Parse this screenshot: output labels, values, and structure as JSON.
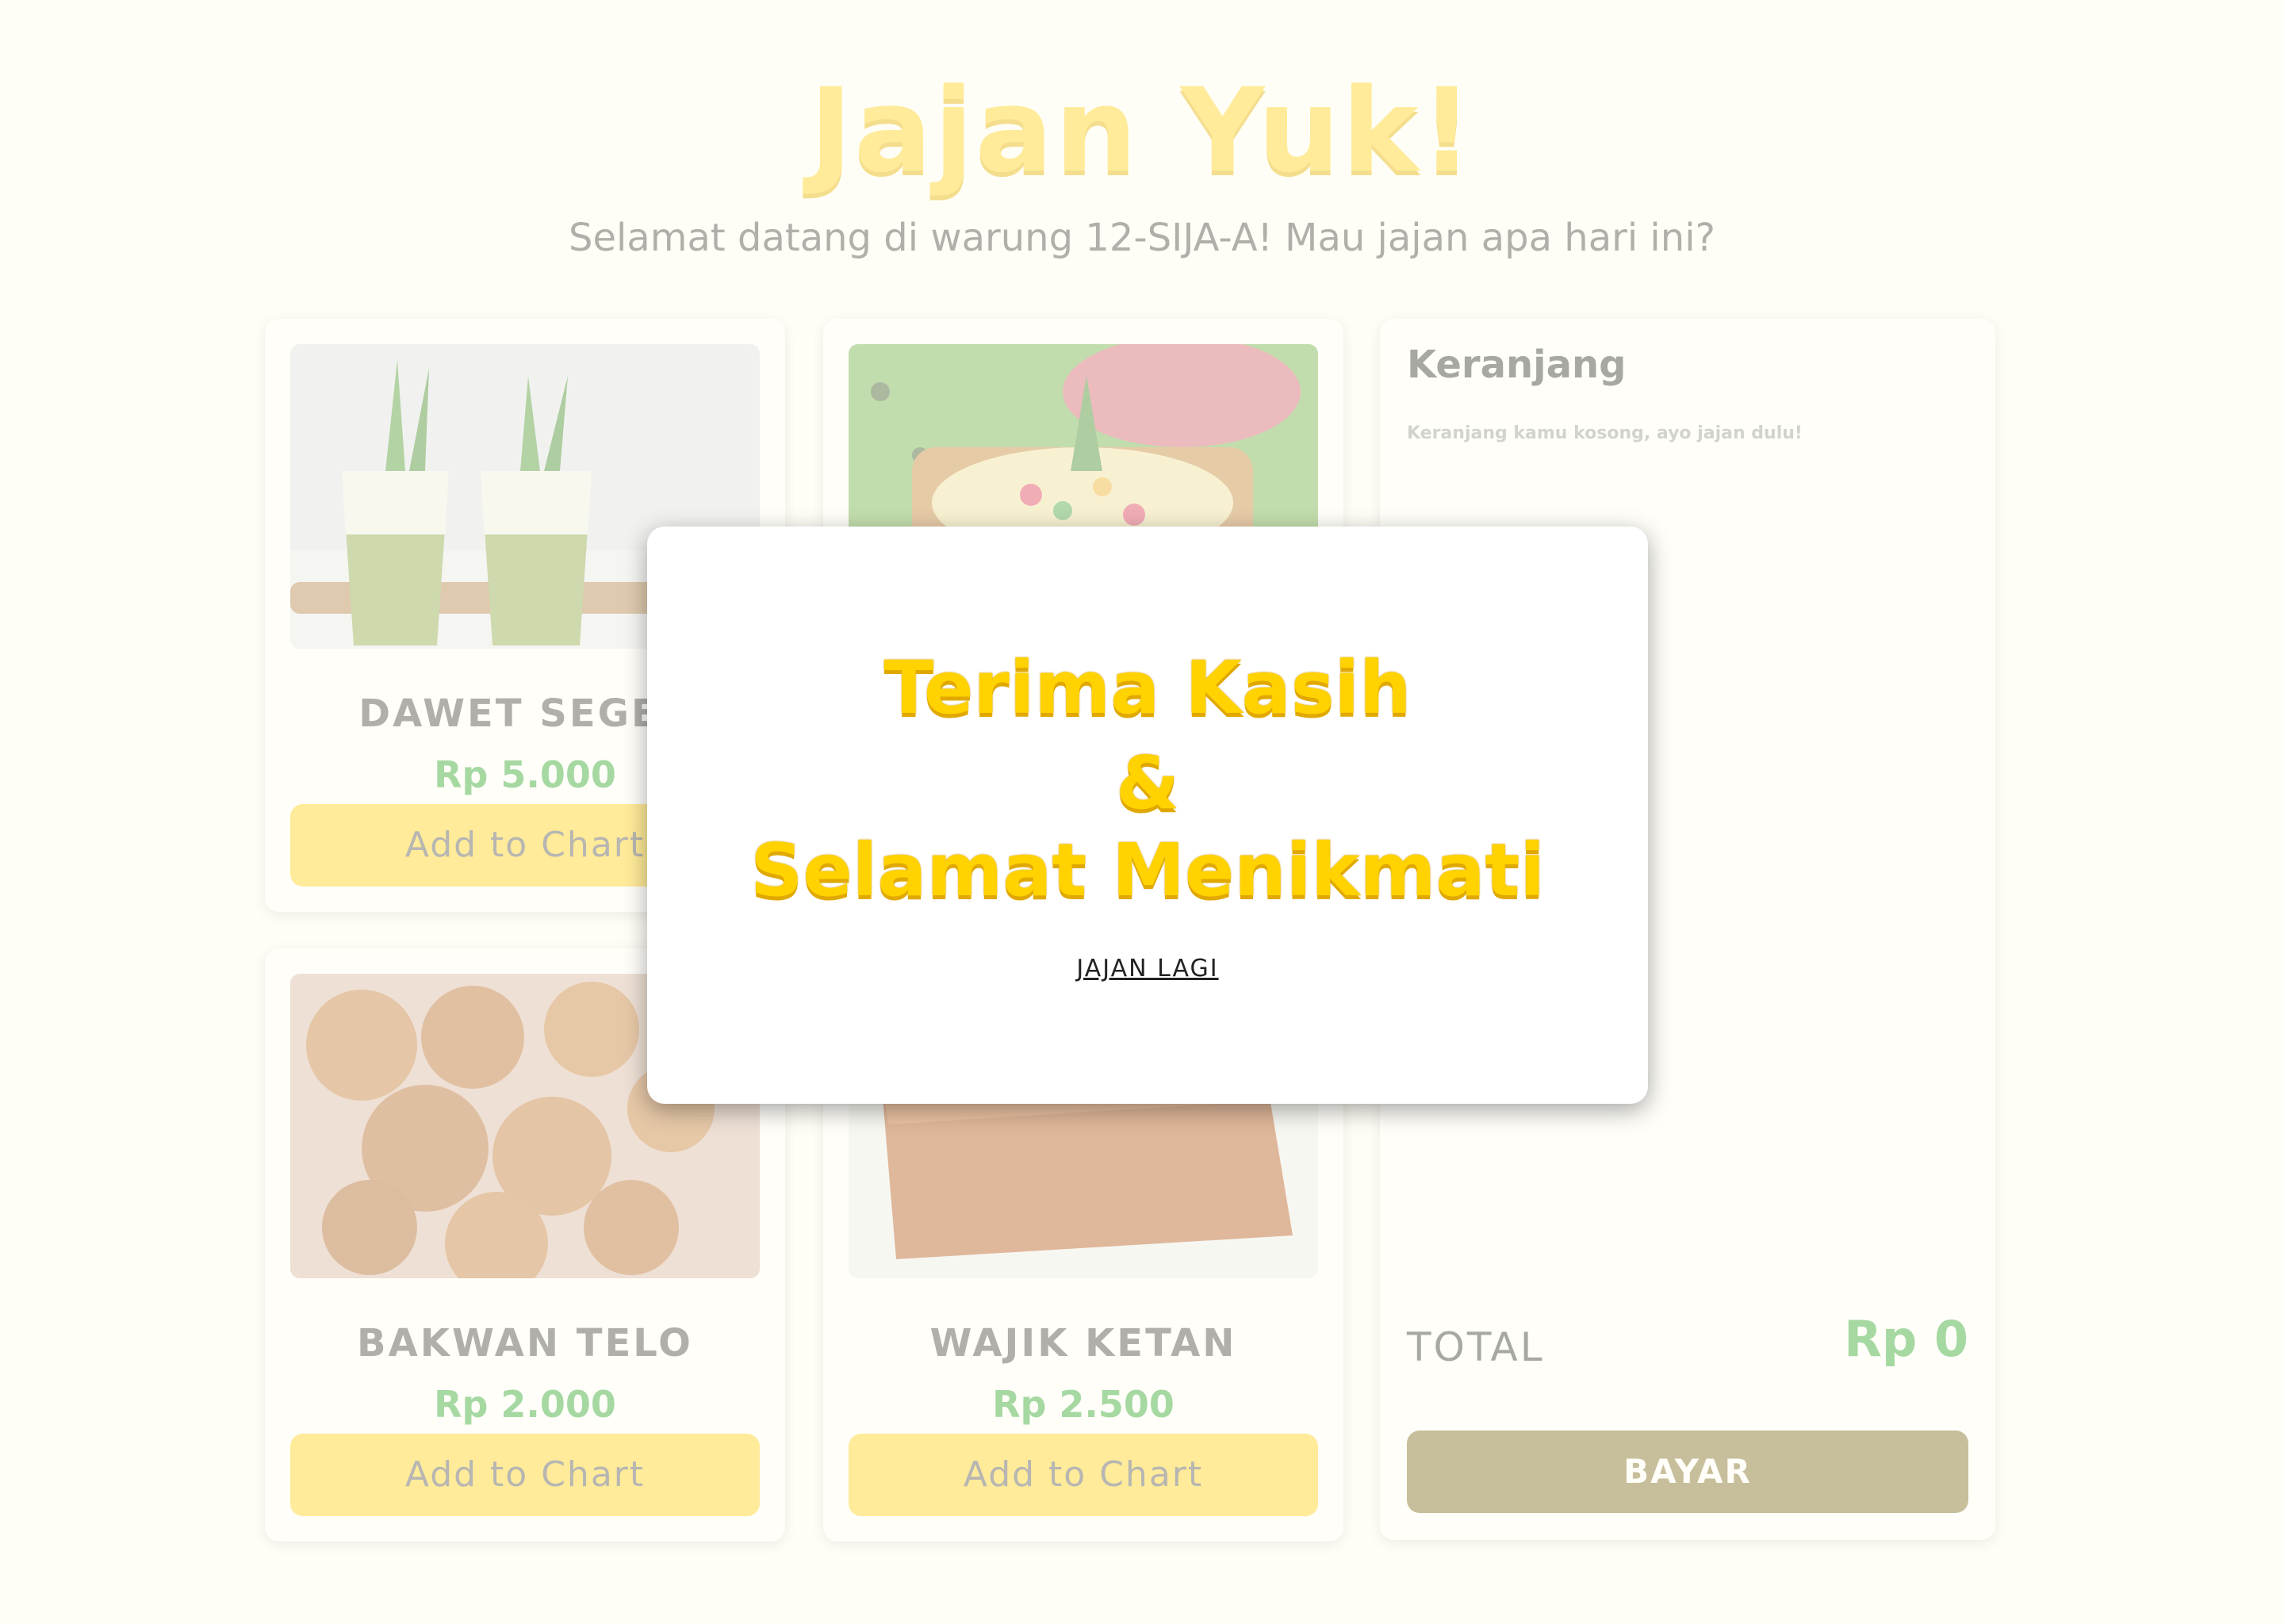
{
  "header": {
    "title": "Jajan Yuk!",
    "subtitle": "Selamat datang di  warung 12-SIJA-A! Mau jajan apa hari ini?"
  },
  "products": [
    {
      "name": "DAWET SEGER",
      "price": "Rp 5.000",
      "button": "Add to Chart",
      "image": "dawet-drink-image"
    },
    {
      "name": "",
      "price": "",
      "button": "",
      "image": "kue-colorful-image"
    },
    {
      "name": "BAKWAN TELO",
      "price": "Rp 2.000",
      "button": "Add to Chart",
      "image": "bakwan-fritter-image"
    },
    {
      "name": "WAJIK KETAN",
      "price": "Rp 2.500",
      "button": "Add to Chart",
      "image": "wajik-sticky-rice-image"
    }
  ],
  "cart": {
    "title": "Keranjang",
    "empty_message": "Keranjang kamu kosong, ayo jajan dulu!",
    "total_label": "TOTAL",
    "total_value": "Rp 0",
    "pay_button": "BAYAR"
  },
  "modal": {
    "line1": "Terima Kasih",
    "line2": "&",
    "line3": "Selamat Menikmati",
    "link": "JAJAN LAGI"
  },
  "colors": {
    "brand_yellow": "#ffd21a",
    "price_green": "#2da62d",
    "pay_button": "#7b6a1f",
    "background": "#fffef6"
  }
}
